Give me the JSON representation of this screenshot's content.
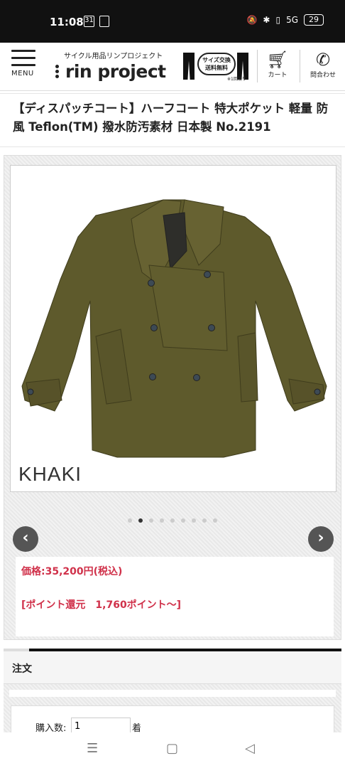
{
  "status": {
    "time": "11:08",
    "battery": "29",
    "cal_day": "31",
    "network": "5G"
  },
  "header": {
    "menu_label": "MENU",
    "logo_sub": "サイクル用品リンプロジェクト",
    "logo_main": "rin project",
    "size_exchange_line1": "サイズ交換",
    "size_exchange_line2": "送料無料",
    "size_exchange_note": "※1回限り",
    "cart_label": "カート",
    "contact_label": "問合わせ"
  },
  "product": {
    "title": "【ディスパッチコート】ハーフコート 特大ポケット 軽量 防風 Teflon(TM) 撥水防汚素材 日本製 No.2191",
    "color_caption": "KHAKI",
    "price": "価格:35,200円(税込)",
    "points": "[ポイント還元　1,760ポイント〜]",
    "coat_color": "#5e5a2c"
  },
  "gallery": {
    "slide_count": 9,
    "active_index": 1
  },
  "order": {
    "heading": "注文",
    "qty_label": "購入数:",
    "qty_value": "1",
    "qty_unit": "着"
  }
}
